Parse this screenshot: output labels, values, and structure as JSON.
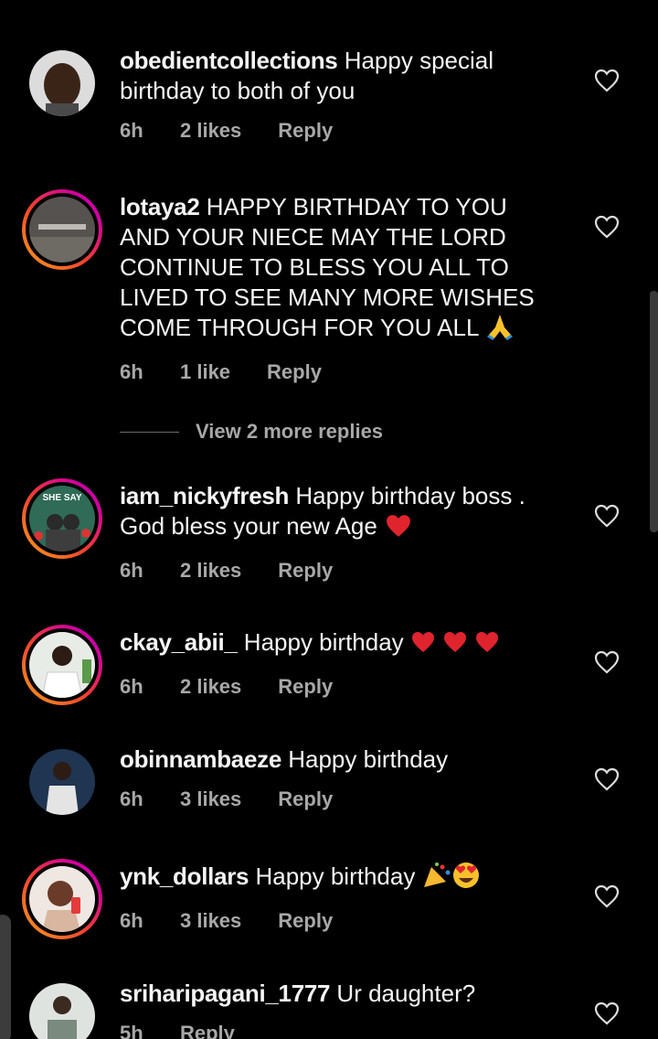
{
  "comments": [
    {
      "username": "obedientcollections",
      "text": "Happy special birthday to both of you",
      "time": "6h",
      "likes": "2 likes",
      "reply": "Reply"
    },
    {
      "username": "lotaya2",
      "text": "HAPPY BIRTHDAY TO YOU AND YOUR NIECE MAY THE LORD CONTINUE TO BLESS YOU ALL TO LIVED TO SEE MANY MORE WISHES COME THROUGH FOR YOU ALL",
      "time": "6h",
      "likes": "1 like",
      "reply": "Reply"
    },
    {
      "username": "iam_nickyfresh",
      "text": "Happy birthday boss . God bless your new Age",
      "time": "6h",
      "likes": "2 likes",
      "reply": "Reply"
    },
    {
      "username": "ckay_abii_",
      "text": "Happy birthday",
      "time": "6h",
      "likes": "2 likes",
      "reply": "Reply"
    },
    {
      "username": "obinnambaeze",
      "text": "Happy birthday",
      "time": "6h",
      "likes": "3 likes",
      "reply": "Reply"
    },
    {
      "username": "ynk_dollars",
      "text": "Happy birthday",
      "time": "6h",
      "likes": "3 likes",
      "reply": "Reply"
    },
    {
      "username": "sriharipagani_1777",
      "text": "Ur daughter?",
      "time": "5h",
      "reply": "Reply"
    }
  ],
  "view_more_replies": "View 2 more replies",
  "avatar_labels": {
    "iam_nickyfresh": "SHE SAY"
  },
  "icons": {
    "like": "heart-outline-icon"
  },
  "colors": {
    "background": "#000000",
    "meta": "#a8a8a8",
    "text": "#f5f5f5",
    "heart_emoji": "#e0242e"
  }
}
